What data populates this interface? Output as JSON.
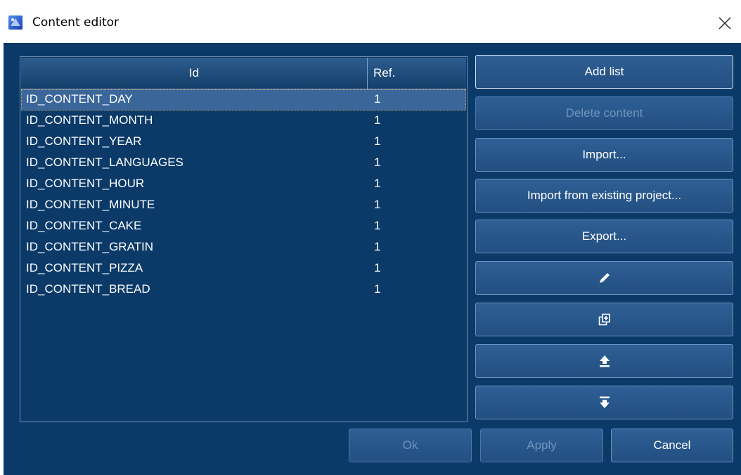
{
  "window": {
    "title": "Content editor",
    "app_icon": "app-logo-icon",
    "close_icon": "close-icon"
  },
  "table": {
    "columns": [
      "Id",
      "Ref."
    ],
    "rows": [
      {
        "id": "ID_CONTENT_DAY",
        "ref": "1"
      },
      {
        "id": "ID_CONTENT_MONTH",
        "ref": "1"
      },
      {
        "id": "ID_CONTENT_YEAR",
        "ref": "1"
      },
      {
        "id": "ID_CONTENT_LANGUAGES",
        "ref": "1"
      },
      {
        "id": "ID_CONTENT_HOUR",
        "ref": "1"
      },
      {
        "id": "ID_CONTENT_MINUTE",
        "ref": "1"
      },
      {
        "id": "ID_CONTENT_CAKE",
        "ref": "1"
      },
      {
        "id": "ID_CONTENT_GRATIN",
        "ref": "1"
      },
      {
        "id": "ID_CONTENT_PIZZA",
        "ref": "1"
      },
      {
        "id": "ID_CONTENT_BREAD",
        "ref": "1"
      }
    ],
    "selected_row": "ID_CONTENT_DAY"
  },
  "side_buttons": {
    "add_list": "Add list",
    "delete_content": "Delete content",
    "import": "Import...",
    "import_existing": "Import from existing project...",
    "export": "Export...",
    "edit_icon": "pencil-icon",
    "duplicate_icon": "duplicate-icon",
    "move_up_icon": "move-up-icon",
    "move_down_icon": "move-down-icon"
  },
  "footer": {
    "ok": "Ok",
    "apply": "Apply",
    "cancel": "Cancel"
  },
  "colors": {
    "background": "#0b3a68",
    "button": "#2a5a8e",
    "selection": "#3b6699",
    "disabled_text": "#6f94bd"
  }
}
